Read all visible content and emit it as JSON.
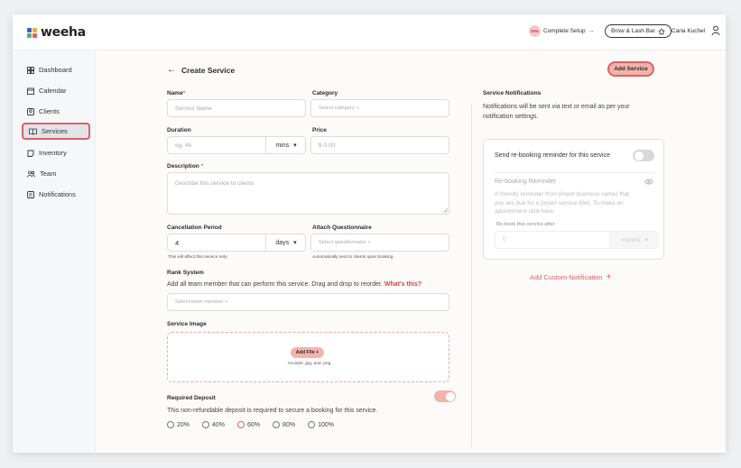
{
  "colors": {
    "accent": "#e06060",
    "accent_soft": "#f3b3ab",
    "toggle_off": "#d8d8d8"
  },
  "brand": {
    "name": "weeha",
    "logo_colors": [
      "#3b5bdb",
      "#f2a93b",
      "#58b368",
      "#e85d5d"
    ]
  },
  "header": {
    "setup_percent": "25%",
    "setup_label": "Complete Setup",
    "setup_arrow": "→",
    "studio_label": "Brow & Lash Bar",
    "user_name": "Carla Kuchel"
  },
  "sidebar": {
    "items": [
      {
        "label": "Dashboard",
        "icon": "dashboard-icon"
      },
      {
        "label": "Calendar",
        "icon": "calendar-icon"
      },
      {
        "label": "Clients",
        "icon": "clients-icon"
      },
      {
        "label": "Services",
        "icon": "services-icon",
        "active": true
      },
      {
        "label": "Inventory",
        "icon": "inventory-icon"
      },
      {
        "label": "Team",
        "icon": "team-icon"
      },
      {
        "label": "Notifications",
        "icon": "notifications-icon"
      }
    ]
  },
  "page": {
    "back_arrow": "←",
    "title": "Create Service",
    "add_button": "Add Service"
  },
  "form": {
    "name": {
      "label": "Name",
      "required_mark": "*",
      "placeholder": "Service Name"
    },
    "category": {
      "label": "Category",
      "placeholder": "Select category +"
    },
    "duration": {
      "label": "Duration",
      "placeholder": "eg. 45",
      "unit": "mins",
      "caret": "▾"
    },
    "price": {
      "label": "Price",
      "placeholder": "$ 0.00"
    },
    "description": {
      "label": "Description",
      "required_mark": "*",
      "placeholder": "Describe this service to clients"
    },
    "cancellation": {
      "label": "Cancellation Period",
      "value": "4",
      "unit": "days",
      "caret": "▾",
      "hint": "This will affect this service only."
    },
    "questionnaire": {
      "label": "Attach Questionnaire",
      "placeholder": "Select questionnaire +",
      "hint": "Automatically sent to clients upon booking."
    },
    "rank": {
      "label": "Rank System",
      "text": "Add all team member that can perform this service. Drag and drop to reorder.",
      "link": "What's this?",
      "placeholder": "Select team member +"
    },
    "image": {
      "label": "Service Image",
      "button": "Add File +",
      "hint": "Accepts .jpg, and .png"
    },
    "deposit": {
      "label": "Required Deposit",
      "text": "This non-refundable deposit is required to secure a booking for this service.",
      "enabled": true,
      "options": [
        "20%",
        "40%",
        "60%",
        "80%",
        "100%"
      ],
      "selected": "60%"
    }
  },
  "notifications": {
    "title": "Service Notifications",
    "text_line1": "Notifications will be sent via text or email as per your",
    "text_line2": "notification settings.",
    "rebooking_toggle_label": "Send re-booking reminder for this service",
    "rebooking_enabled": false,
    "reminder_title": "Re-booking Reminder",
    "reminder_line1": "A friendly reminder from {insert business name} that",
    "reminder_line2": "you are due for a {insert service title}. To make an",
    "reminder_line3": "appointment click here.",
    "rebook_after_label": "Re-book this service after",
    "rebook_value": "0",
    "rebook_unit": "months",
    "rebook_caret": "▾",
    "add_custom": "Add Custom Notification",
    "add_custom_icon": "+"
  }
}
